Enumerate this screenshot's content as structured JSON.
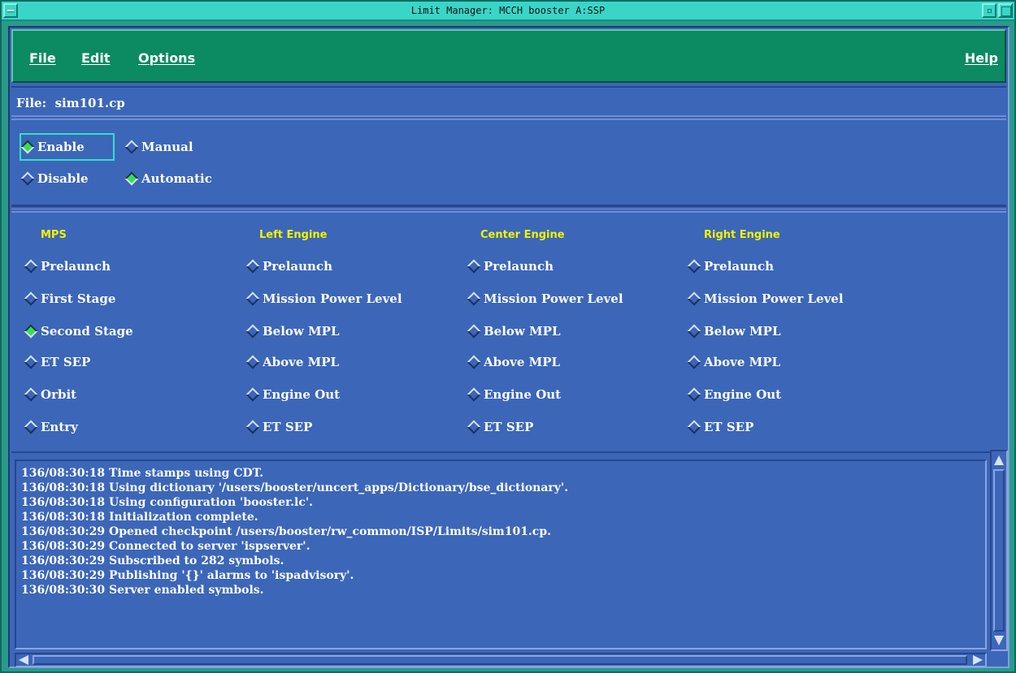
{
  "window": {
    "title": "Limit Manager: MCCH booster A:SSP"
  },
  "menubar": {
    "file": "File",
    "edit": "Edit",
    "options": "Options",
    "help": "Help"
  },
  "file_line": {
    "text": "File:  sim101.cp"
  },
  "modes": {
    "enable": {
      "label": "Enable",
      "selected": true
    },
    "disable": {
      "label": "Disable",
      "selected": false
    },
    "manual": {
      "label": "Manual",
      "selected": false
    },
    "automatic": {
      "label": "Automatic",
      "selected": true
    }
  },
  "columns": [
    {
      "header": "MPS",
      "items": [
        {
          "label": "Prelaunch",
          "selected": false
        },
        {
          "label": "First Stage",
          "selected": false
        },
        {
          "label": "Second Stage",
          "selected": true
        },
        {
          "label": "ET SEP",
          "selected": false
        },
        {
          "label": "Orbit",
          "selected": false
        },
        {
          "label": "Entry",
          "selected": false
        }
      ]
    },
    {
      "header": "Left Engine",
      "items": [
        {
          "label": "Prelaunch",
          "selected": false
        },
        {
          "label": "Mission Power Level",
          "selected": false
        },
        {
          "label": "Below MPL",
          "selected": false
        },
        {
          "label": "Above MPL",
          "selected": false
        },
        {
          "label": "Engine Out",
          "selected": false
        },
        {
          "label": "ET SEP",
          "selected": false
        }
      ]
    },
    {
      "header": "Center Engine",
      "items": [
        {
          "label": "Prelaunch",
          "selected": false
        },
        {
          "label": "Mission Power Level",
          "selected": false
        },
        {
          "label": "Below MPL",
          "selected": false
        },
        {
          "label": "Above MPL",
          "selected": false
        },
        {
          "label": "Engine Out",
          "selected": false
        },
        {
          "label": "ET SEP",
          "selected": false
        }
      ]
    },
    {
      "header": "Right Engine",
      "items": [
        {
          "label": "Prelaunch",
          "selected": false
        },
        {
          "label": "Mission Power Level",
          "selected": false
        },
        {
          "label": "Below MPL",
          "selected": false
        },
        {
          "label": "Above MPL",
          "selected": false
        },
        {
          "label": "Engine Out",
          "selected": false
        },
        {
          "label": "ET SEP",
          "selected": false
        }
      ]
    }
  ],
  "log": [
    "136/08:30:18 Time stamps using CDT.",
    "136/08:30:18 Using dictionary '/users/booster/uncert_apps/Dictionary/bse_dictionary'.",
    "136/08:30:18 Using configuration 'booster.lc'.",
    "136/08:30:18 Initialization complete.",
    "136/08:30:29 Opened checkpoint /users/booster/rw_common/ISP/Limits/sim101.cp.",
    "136/08:30:29 Connected to server 'ispserver'.",
    "136/08:30:29 Subscribed to 282 symbols.",
    "136/08:30:29 Publishing '{}' alarms to 'ispadvisory'.",
    "136/08:30:30 Server enabled symbols."
  ],
  "colors": {
    "panel": "#3c66b8",
    "menubar": "#0c8a62",
    "titlebar": "#39d6c7",
    "header_yellow": "#f2f200",
    "selected_green": "#35e048"
  }
}
